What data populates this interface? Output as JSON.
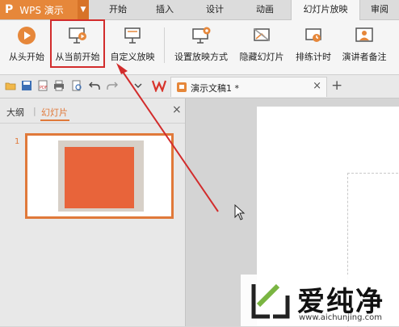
{
  "app": {
    "logo": "P",
    "name": "WPS 演示"
  },
  "tabs": [
    "开始",
    "插入",
    "设计",
    "动画",
    "幻灯片放映",
    "审阅"
  ],
  "active_tab": "幻灯片放映",
  "ribbon": {
    "from_start": "从头开始",
    "from_current": "从当前开始",
    "custom_show": "自定义放映",
    "setup_show": "设置放映方式",
    "hide_slide": "隐藏幻灯片",
    "rehearse": "排练计时",
    "presenter_notes": "演讲者备注"
  },
  "document_tab": {
    "title": "演示文稿1 *",
    "close": "×",
    "add": "+"
  },
  "left_panel": {
    "outline_tab": "大纲",
    "slides_tab": "幻灯片",
    "close": "×",
    "slide_number": "1"
  },
  "watermark": {
    "brand": "爱纯净",
    "url": "www.aichunjing.com"
  },
  "colors": {
    "accent": "#e6873a",
    "highlight": "#d22c2c",
    "slide_fill": "#e8643a"
  },
  "icons": [
    "play-icon",
    "play-current-icon",
    "screen-icon",
    "settings-screen-icon",
    "hide-slide-icon",
    "timer-icon",
    "presenter-icon"
  ]
}
